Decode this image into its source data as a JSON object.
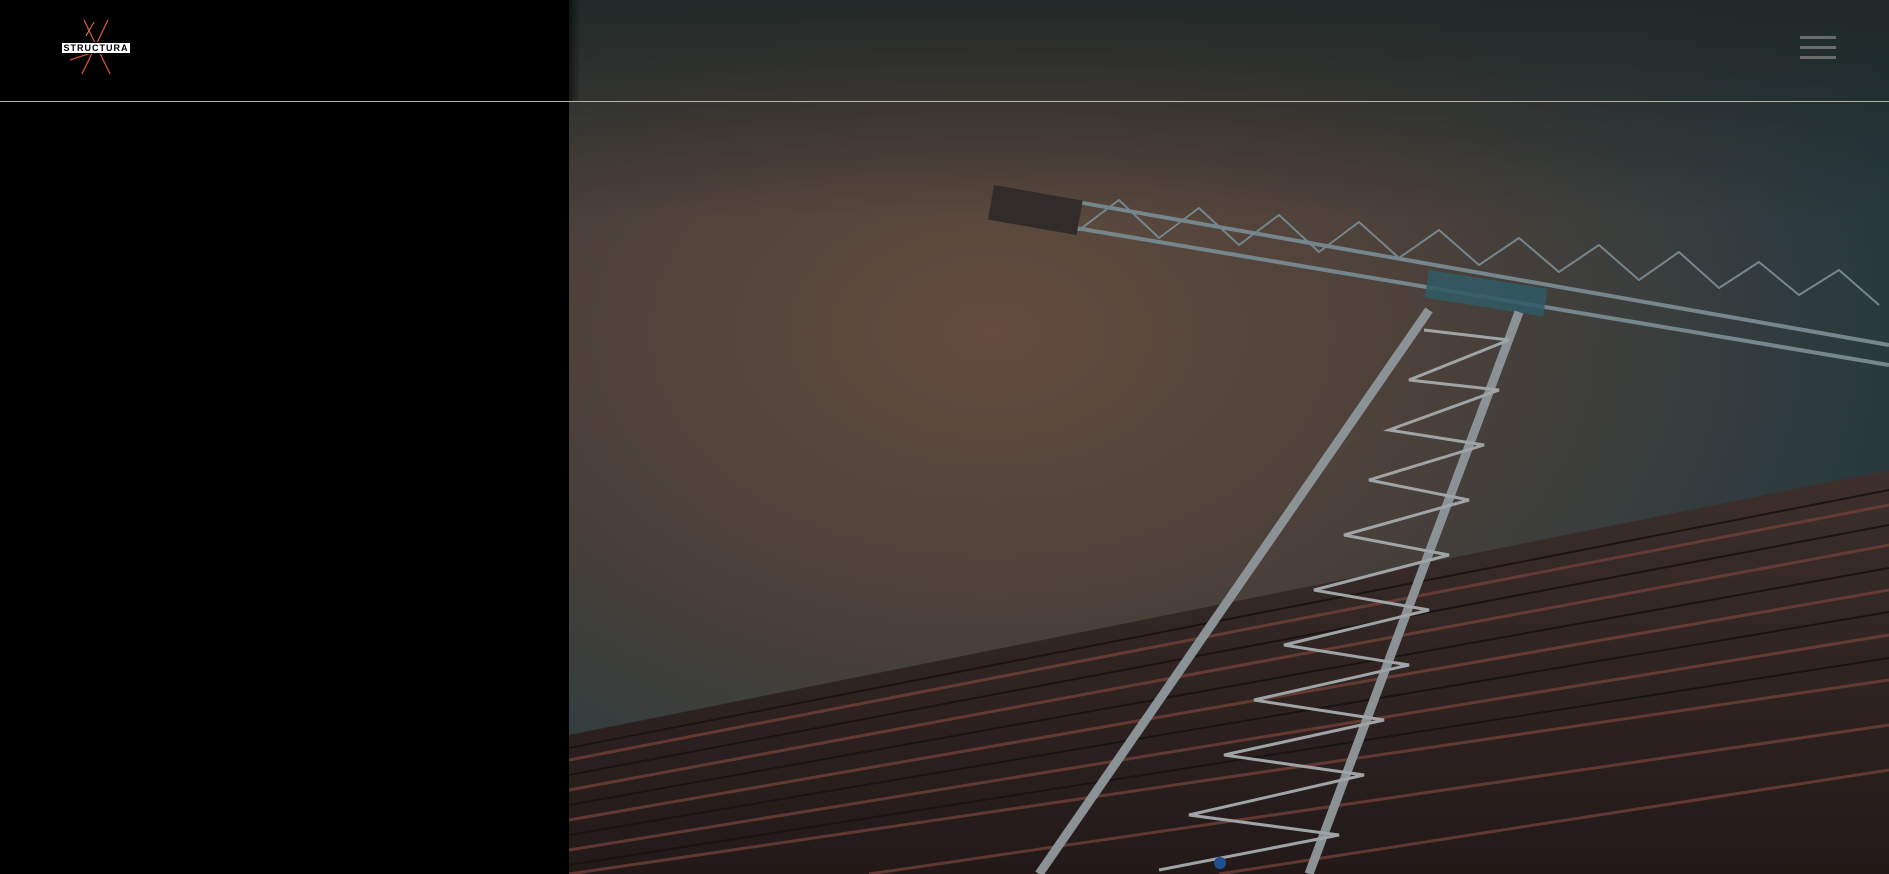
{
  "header": {
    "logo_text": "STRUCTURA",
    "menu_icon": "hamburger-menu-icon"
  },
  "hero": {
    "image_description_icon": "construction-crane-photo",
    "colors": {
      "sky_top": "#2b3638",
      "sky_warm": "#6e5a4a",
      "sky_cool": "#2f4f56",
      "building": "#3a2a28",
      "crane": "#9aa3a8"
    }
  },
  "slider": {
    "active_index": 1,
    "dot_color": "#1f4f8f"
  }
}
